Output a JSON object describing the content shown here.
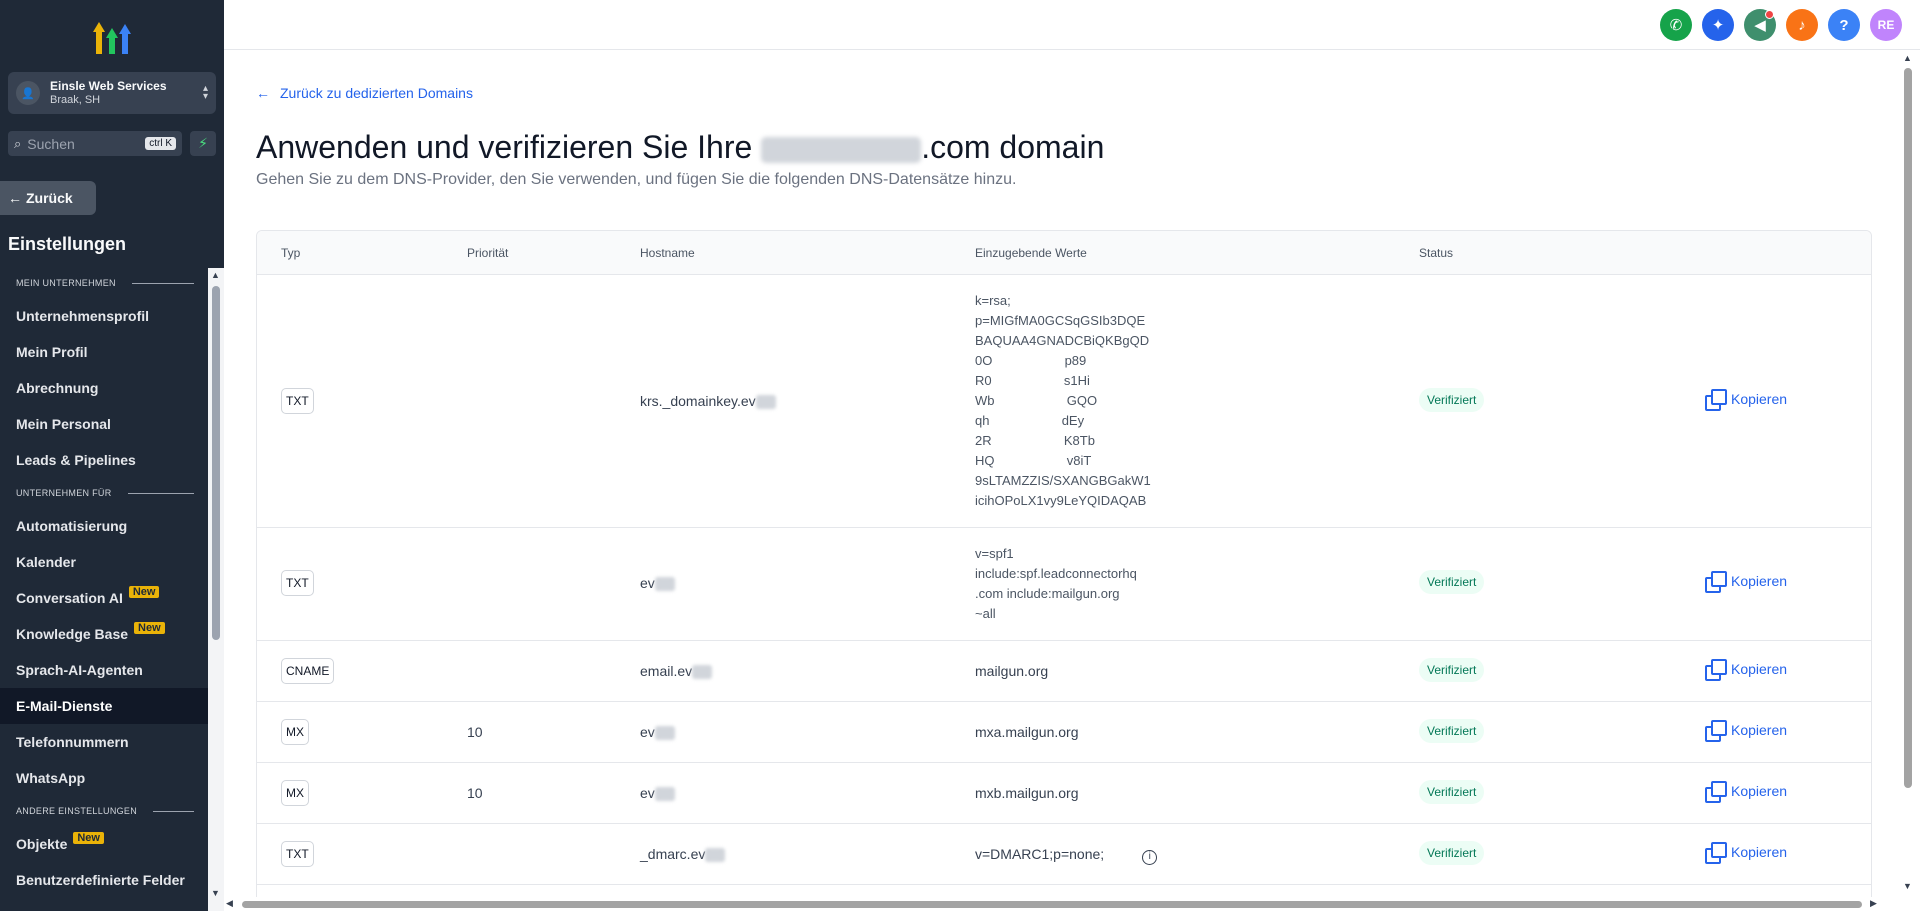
{
  "sidebar": {
    "account_name": "Einsle Web Services",
    "account_location": "Braak, SH",
    "search_placeholder": "Suchen",
    "search_shortcut": "ctrl K",
    "back_label": "Zurück",
    "settings_title": "Einstellungen",
    "sections": [
      {
        "label": "MEIN UNTERNEHMEN",
        "items": [
          {
            "label": "Unternehmensprofil"
          },
          {
            "label": "Mein Profil"
          },
          {
            "label": "Abrechnung"
          },
          {
            "label": "Mein Personal"
          },
          {
            "label": "Leads & Pipelines"
          }
        ]
      },
      {
        "label": "UNTERNEHMEN FÜR",
        "items": [
          {
            "label": "Automatisierung"
          },
          {
            "label": "Kalender"
          },
          {
            "label": "Conversation AI",
            "badge": "New"
          },
          {
            "label": "Knowledge Base",
            "badge": "New"
          },
          {
            "label": "Sprach-AI-Agenten"
          },
          {
            "label": "E-Mail-Dienste",
            "active": true
          },
          {
            "label": "Telefonnummern"
          },
          {
            "label": "WhatsApp"
          }
        ]
      },
      {
        "label": "ANDERE EINSTELLUNGEN",
        "items": [
          {
            "label": "Objekte",
            "badge": "New"
          },
          {
            "label": "Benutzerdefinierte Felder"
          }
        ]
      }
    ]
  },
  "topbar": {
    "icons": [
      {
        "name": "phone-icon",
        "color": "#16a34a",
        "glyph": "✆"
      },
      {
        "name": "ai-sparkle-icon",
        "color": "#2563eb",
        "glyph": "✦"
      },
      {
        "name": "megaphone-icon",
        "color": "#3f8f6d",
        "glyph": "📣",
        "dot": true
      },
      {
        "name": "bell-icon",
        "color": "#f97316",
        "glyph": "🔔"
      },
      {
        "name": "help-icon",
        "color": "#3b82f6",
        "glyph": "?"
      },
      {
        "name": "avatar",
        "color": "#c084fc",
        "glyph": "RE"
      }
    ]
  },
  "main": {
    "back_link": "Zurück zu dedizierten Domains",
    "title_prefix": "Anwenden und verifizieren Sie Ihre ",
    "title_suffix": ".com domain",
    "subtitle": "Gehen Sie zu dem DNS-Provider, den Sie verwenden, und fügen Sie die folgenden DNS-Datensätze hinzu.",
    "table": {
      "headers": {
        "type": "Typ",
        "priority": "Priorität",
        "hostname": "Hostname",
        "values": "Einzugebende Werte",
        "status": "Status"
      },
      "rows": [
        {
          "type": "TXT",
          "priority": "",
          "hostname": "krs._domainkey.ev",
          "value": "k=rsa;\np=MIGfMA0GCSqGSIb3DQE\nBAQUAA4GNADCBiQKBgQD\n0O                    p89\nR0                    s1Hi\nWb                    GQO\nqh                    dEy\n2R                    K8Tb\nHQ                    v8iT\n9sLTAMZZIS/SXANGBGakW1\nicihOPoLX1vy9LeYQIDAQAB",
          "status": "Verifiziert",
          "action": "Kopieren"
        },
        {
          "type": "TXT",
          "priority": "",
          "hostname": "ev",
          "value": "v=spf1\ninclude:spf.leadconnectorhq\n.com include:mailgun.org\n~all",
          "status": "Verifiziert",
          "action": "Kopieren"
        },
        {
          "type": "CNAME",
          "priority": "",
          "hostname": "email.ev",
          "value": "mailgun.org",
          "status": "Verifiziert",
          "action": "Kopieren"
        },
        {
          "type": "MX",
          "priority": "10",
          "hostname": "ev",
          "value": "mxa.mailgun.org",
          "status": "Verifiziert",
          "action": "Kopieren"
        },
        {
          "type": "MX",
          "priority": "10",
          "hostname": "ev",
          "value": "mxb.mailgun.org",
          "status": "Verifiziert",
          "action": "Kopieren"
        },
        {
          "type": "TXT",
          "priority": "",
          "hostname": "_dmarc.ev",
          "value": "v=DMARC1;p=none;",
          "status": "Verifiziert",
          "action": "Kopieren",
          "info": true
        }
      ]
    }
  }
}
